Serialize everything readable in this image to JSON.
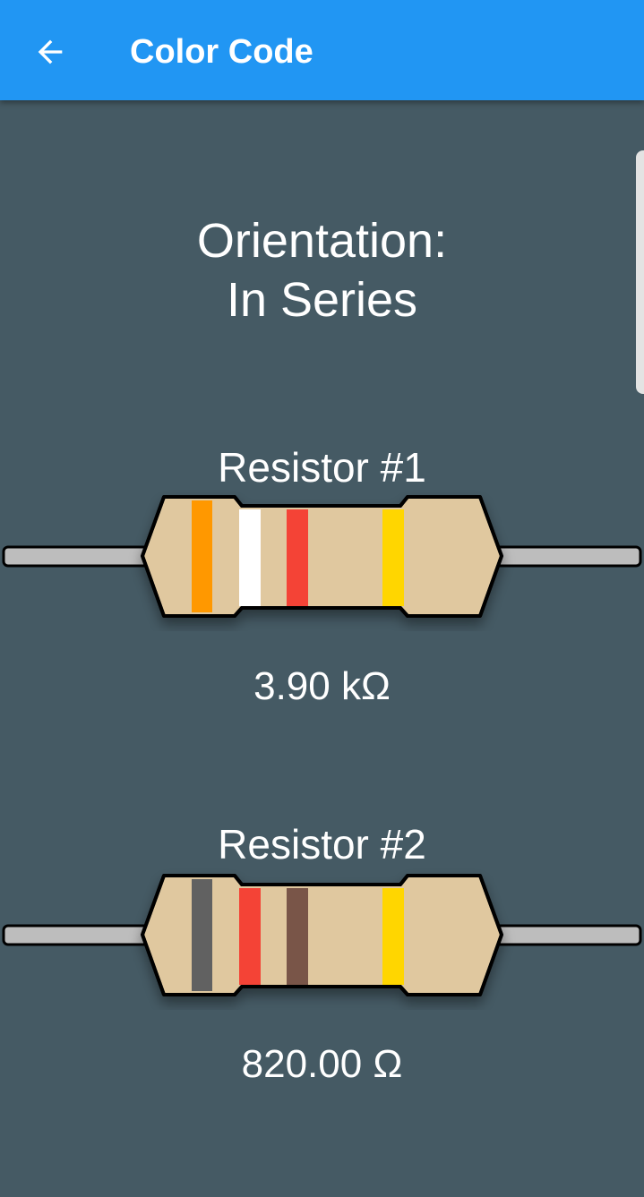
{
  "appbar": {
    "title": "Color Code",
    "back_icon": "arrow-back-icon",
    "background": "#2196f3"
  },
  "orientation": {
    "line1": "Orientation:",
    "line2": "In Series"
  },
  "resistors": [
    {
      "label": "Resistor #1",
      "value": "3.90 kΩ",
      "bands": [
        "orange",
        "white",
        "red",
        "gold"
      ],
      "band_colors": [
        "#ff9800",
        "#ffffff",
        "#f44336",
        "#ffd600"
      ]
    },
    {
      "label": "Resistor #2",
      "value": "820.00 Ω",
      "bands": [
        "grey",
        "red",
        "brown",
        "gold"
      ],
      "band_colors": [
        "#616161",
        "#f44336",
        "#795548",
        "#ffd600"
      ]
    }
  ],
  "colors": {
    "background": "#455a64",
    "resistor_body": "#e0c89f",
    "lead": "#bdbdbd"
  }
}
